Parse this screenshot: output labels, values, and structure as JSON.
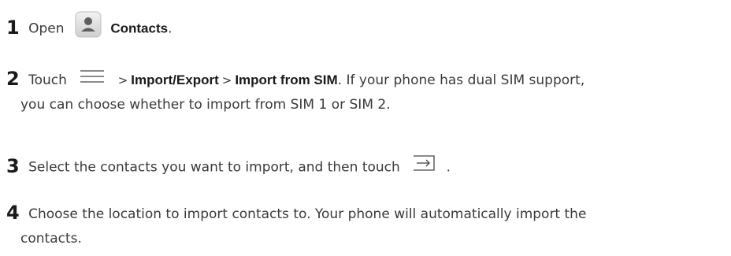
{
  "steps": [
    {
      "number": "1",
      "before": "Open",
      "app": "Contacts",
      "after": "."
    },
    {
      "number": "2",
      "before": "Touch",
      "sep": ">",
      "menu1": "Import/Export",
      "menu2": "Import from SIM",
      "rest_line1": ". If your phone has dual SIM support,",
      "rest_line2": "you can choose whether to import from SIM 1 or SIM 2."
    },
    {
      "number": "3",
      "text": "Select the contacts you want to import, and then touch",
      "after": "."
    },
    {
      "number": "4",
      "line1": "Choose the location to import contacts to. Your phone will automatically import the",
      "line2": "contacts."
    }
  ],
  "icons": {
    "contacts": "contacts-app-icon",
    "menu": "menu-lines-icon",
    "import": "import-arrow-icon"
  }
}
